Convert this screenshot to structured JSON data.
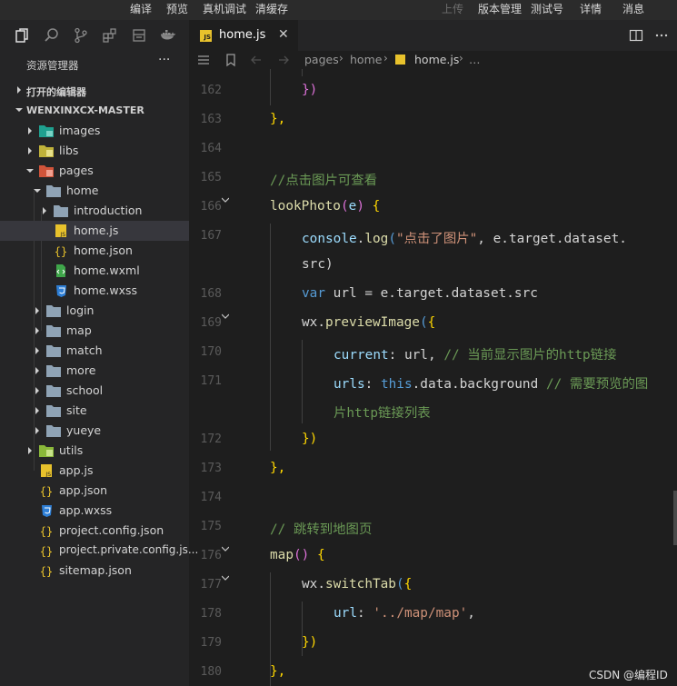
{
  "menu": {
    "compile": "编译",
    "preview": "预览",
    "real_debug": "真机调试",
    "clear_cache": "清缓存",
    "upload": "上传",
    "version": "版本管理",
    "test_account": "测试号",
    "details": "详情",
    "messages": "消息"
  },
  "sidebar": {
    "title": "资源管理器",
    "more": "···",
    "open_editors": "打开的编辑器",
    "project": "WENXINXCX-MASTER",
    "tree": [
      {
        "label": "images"
      },
      {
        "label": "libs"
      },
      {
        "label": "pages"
      },
      {
        "label": "home"
      },
      {
        "label": "introduction"
      },
      {
        "label": "home.js"
      },
      {
        "label": "home.json"
      },
      {
        "label": "home.wxml"
      },
      {
        "label": "home.wxss"
      },
      {
        "label": "login"
      },
      {
        "label": "map"
      },
      {
        "label": "match"
      },
      {
        "label": "more"
      },
      {
        "label": "school"
      },
      {
        "label": "site"
      },
      {
        "label": "yueye"
      },
      {
        "label": "utils"
      },
      {
        "label": "app.js"
      },
      {
        "label": "app.json"
      },
      {
        "label": "app.wxss"
      },
      {
        "label": "project.config.json"
      },
      {
        "label": "project.private.config.js..."
      },
      {
        "label": "sitemap.json"
      }
    ]
  },
  "tab": {
    "name": "home.js",
    "close": "✕",
    "js_badge": "JS"
  },
  "breadcrumb": {
    "pages": "pages",
    "home": "home",
    "file": "home.js",
    "ellipsis": "…",
    "sep": "›"
  },
  "editor": {
    "line_numbers": [
      "162",
      "163",
      "164",
      "165",
      "166",
      "167",
      "168",
      "169",
      "170",
      "171",
      "172",
      "173",
      "174",
      "175",
      "176",
      "177",
      "178",
      "179",
      "180"
    ],
    "code": {
      "l162": "})",
      "l163": "},",
      "l165": "//点击图片可查看",
      "l166_fn": "lookPhoto",
      "l166_param": "e",
      "l167_obj": "console",
      "l167_fn": "log",
      "l167_str": "\"点击了图片\"",
      "l167_rest": ", e.target.dataset.",
      "l167_wrap": "src)",
      "l168_kw": "var",
      "l168_rest": " url = e.target.dataset.src",
      "l169_obj": "wx.",
      "l169_fn": "previewImage",
      "l170_key": "current",
      "l170_val": ": url, ",
      "l170_comment": "// 当前显示图片的http链接",
      "l171_key": "urls",
      "l171_this": "this",
      "l171_val": ".data.background ",
      "l171_comment": "// 需要预览的图",
      "l171_wrap": "片http链接列表",
      "l172": "})",
      "l173": "},",
      "l175": "// 跳转到地图页",
      "l176_fn": "map",
      "l177_obj": "wx.",
      "l177_fn": "switchTab",
      "l178_key": "url",
      "l178_str": "'../map/map'",
      "l178_comma": ",",
      "l179": "})",
      "l180": "},"
    }
  },
  "watermark": "CSDN @编程ID",
  "colors": {
    "keyword": "#569cd6",
    "function": "#dcdcaa",
    "string": "#ce9178",
    "comment": "#6a9955",
    "property": "#9cdcfe",
    "bracket1": "#ffd700",
    "bracket2": "#da70d6"
  }
}
